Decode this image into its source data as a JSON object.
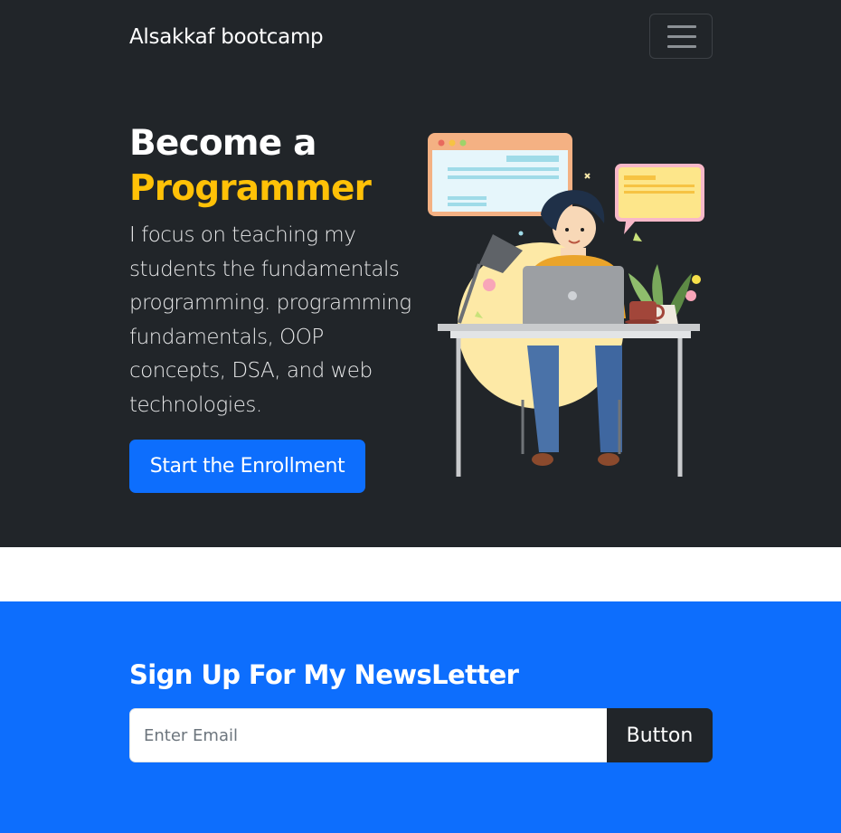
{
  "navbar": {
    "brand": "Alsakkaf bootcamp",
    "toggler_icon": "hamburger-menu-icon"
  },
  "hero": {
    "title_line1": "Become a",
    "title_line2": "Programmer",
    "lead": "I focus on teaching my students the fundamentals programming. programming fundamentals, OOP concepts, DSA, and web technologies.",
    "cta_label": "Start the Enrollment",
    "illustration": "programmer-at-desk-illustration"
  },
  "newsletter": {
    "title": "Sign Up For My NewsLetter",
    "email_placeholder": "Enter Email",
    "email_value": "",
    "button_label": "Button"
  },
  "colors": {
    "dark_bg": "#212529",
    "primary": "#0d6efd",
    "accent": "#ffc107",
    "white": "#ffffff"
  }
}
